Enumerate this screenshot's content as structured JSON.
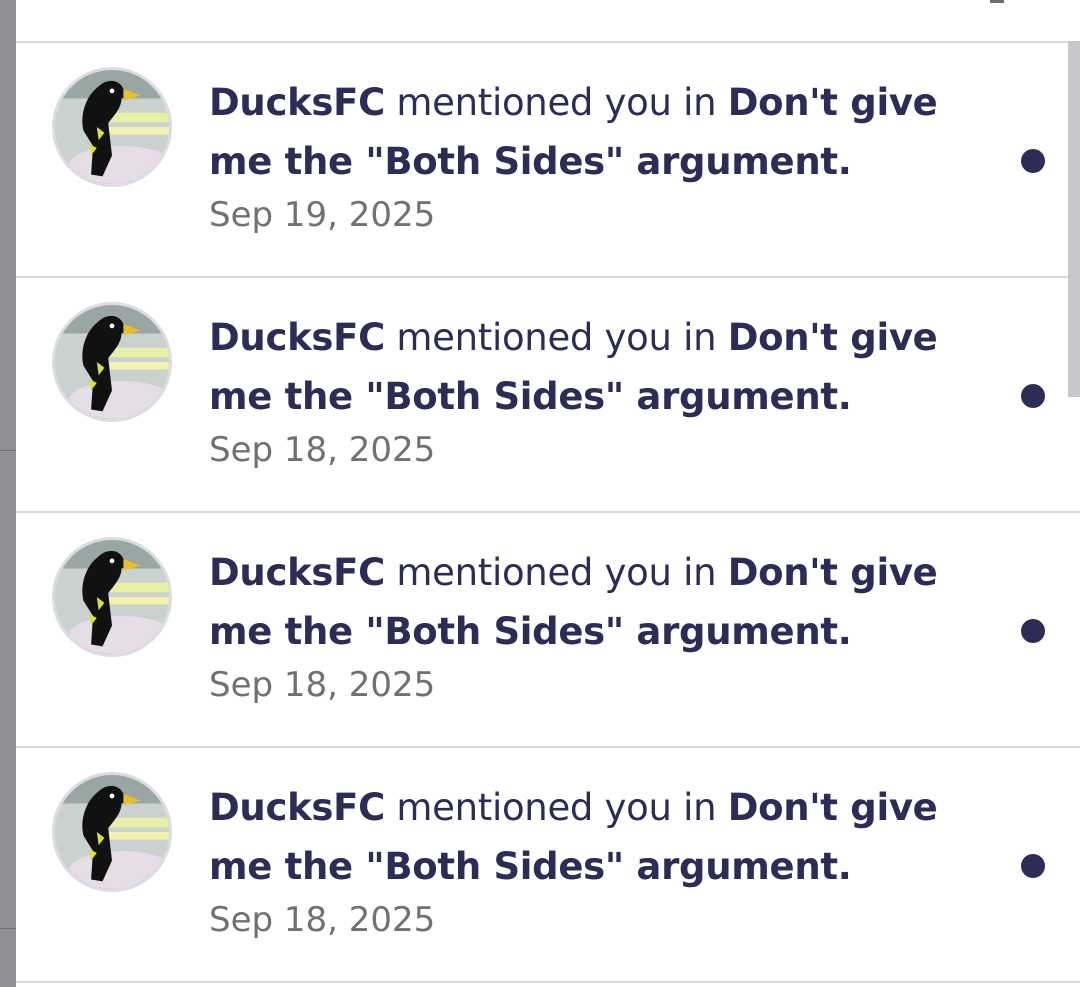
{
  "notifications": [
    {
      "user": "DucksFC",
      "action": " mentioned you in ",
      "thread": "Don't give me the \"Both Sides\" argument.",
      "date": "Sep 19, 2025",
      "unread": true
    },
    {
      "user": "DucksFC",
      "action": " mentioned you in ",
      "thread": "Don't give me the \"Both Sides\" argument.",
      "date": "Sep 18, 2025",
      "unread": true
    },
    {
      "user": "DucksFC",
      "action": " mentioned you in ",
      "thread": "Don't give me the \"Both Sides\" argument.",
      "date": "Sep 18, 2025",
      "unread": true
    },
    {
      "user": "DucksFC",
      "action": " mentioned you in ",
      "thread": "Don't give me the \"Both Sides\" argument.",
      "date": "Sep 18, 2025",
      "unread": true
    }
  ],
  "colors": {
    "text_primary": "#2d2c56",
    "text_secondary": "#707075",
    "unread_dot": "#2d2c56",
    "divider": "#d9d9dd"
  },
  "icons": {
    "avatar": "duck-mascot-avatar",
    "unread": "unread-dot-icon"
  }
}
